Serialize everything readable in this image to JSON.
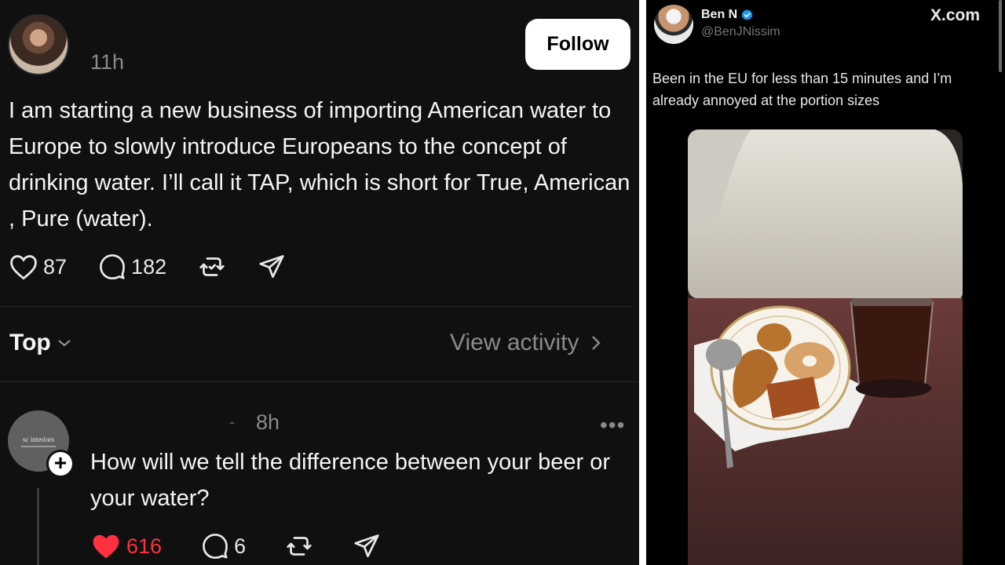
{
  "left_post": {
    "time": "11h",
    "follow_label": "Follow",
    "text": "I am starting a new business of importing American water to Europe to slowly introduce Europeans to the concept of drinking water. I’ll call it TAP, which is short for True, American , Pure (water).",
    "likes": "87",
    "comments": "182",
    "sort_label": "Top",
    "view_activity_label": "View activity"
  },
  "reply": {
    "avatar_text": "sc interiors",
    "time": "8h",
    "more": "•••",
    "text": "How will we tell the difference between your beer or your water?",
    "likes": "616",
    "comments": "6",
    "like_color": "#ff3040"
  },
  "tweet": {
    "name": "Ben N",
    "handle": "@BenJNissim",
    "brand": "X.com",
    "text": "Been in the EU for less than 15 minutes and I’m already annoyed at the portion sizes",
    "verified_color": "#1d9bf0"
  }
}
